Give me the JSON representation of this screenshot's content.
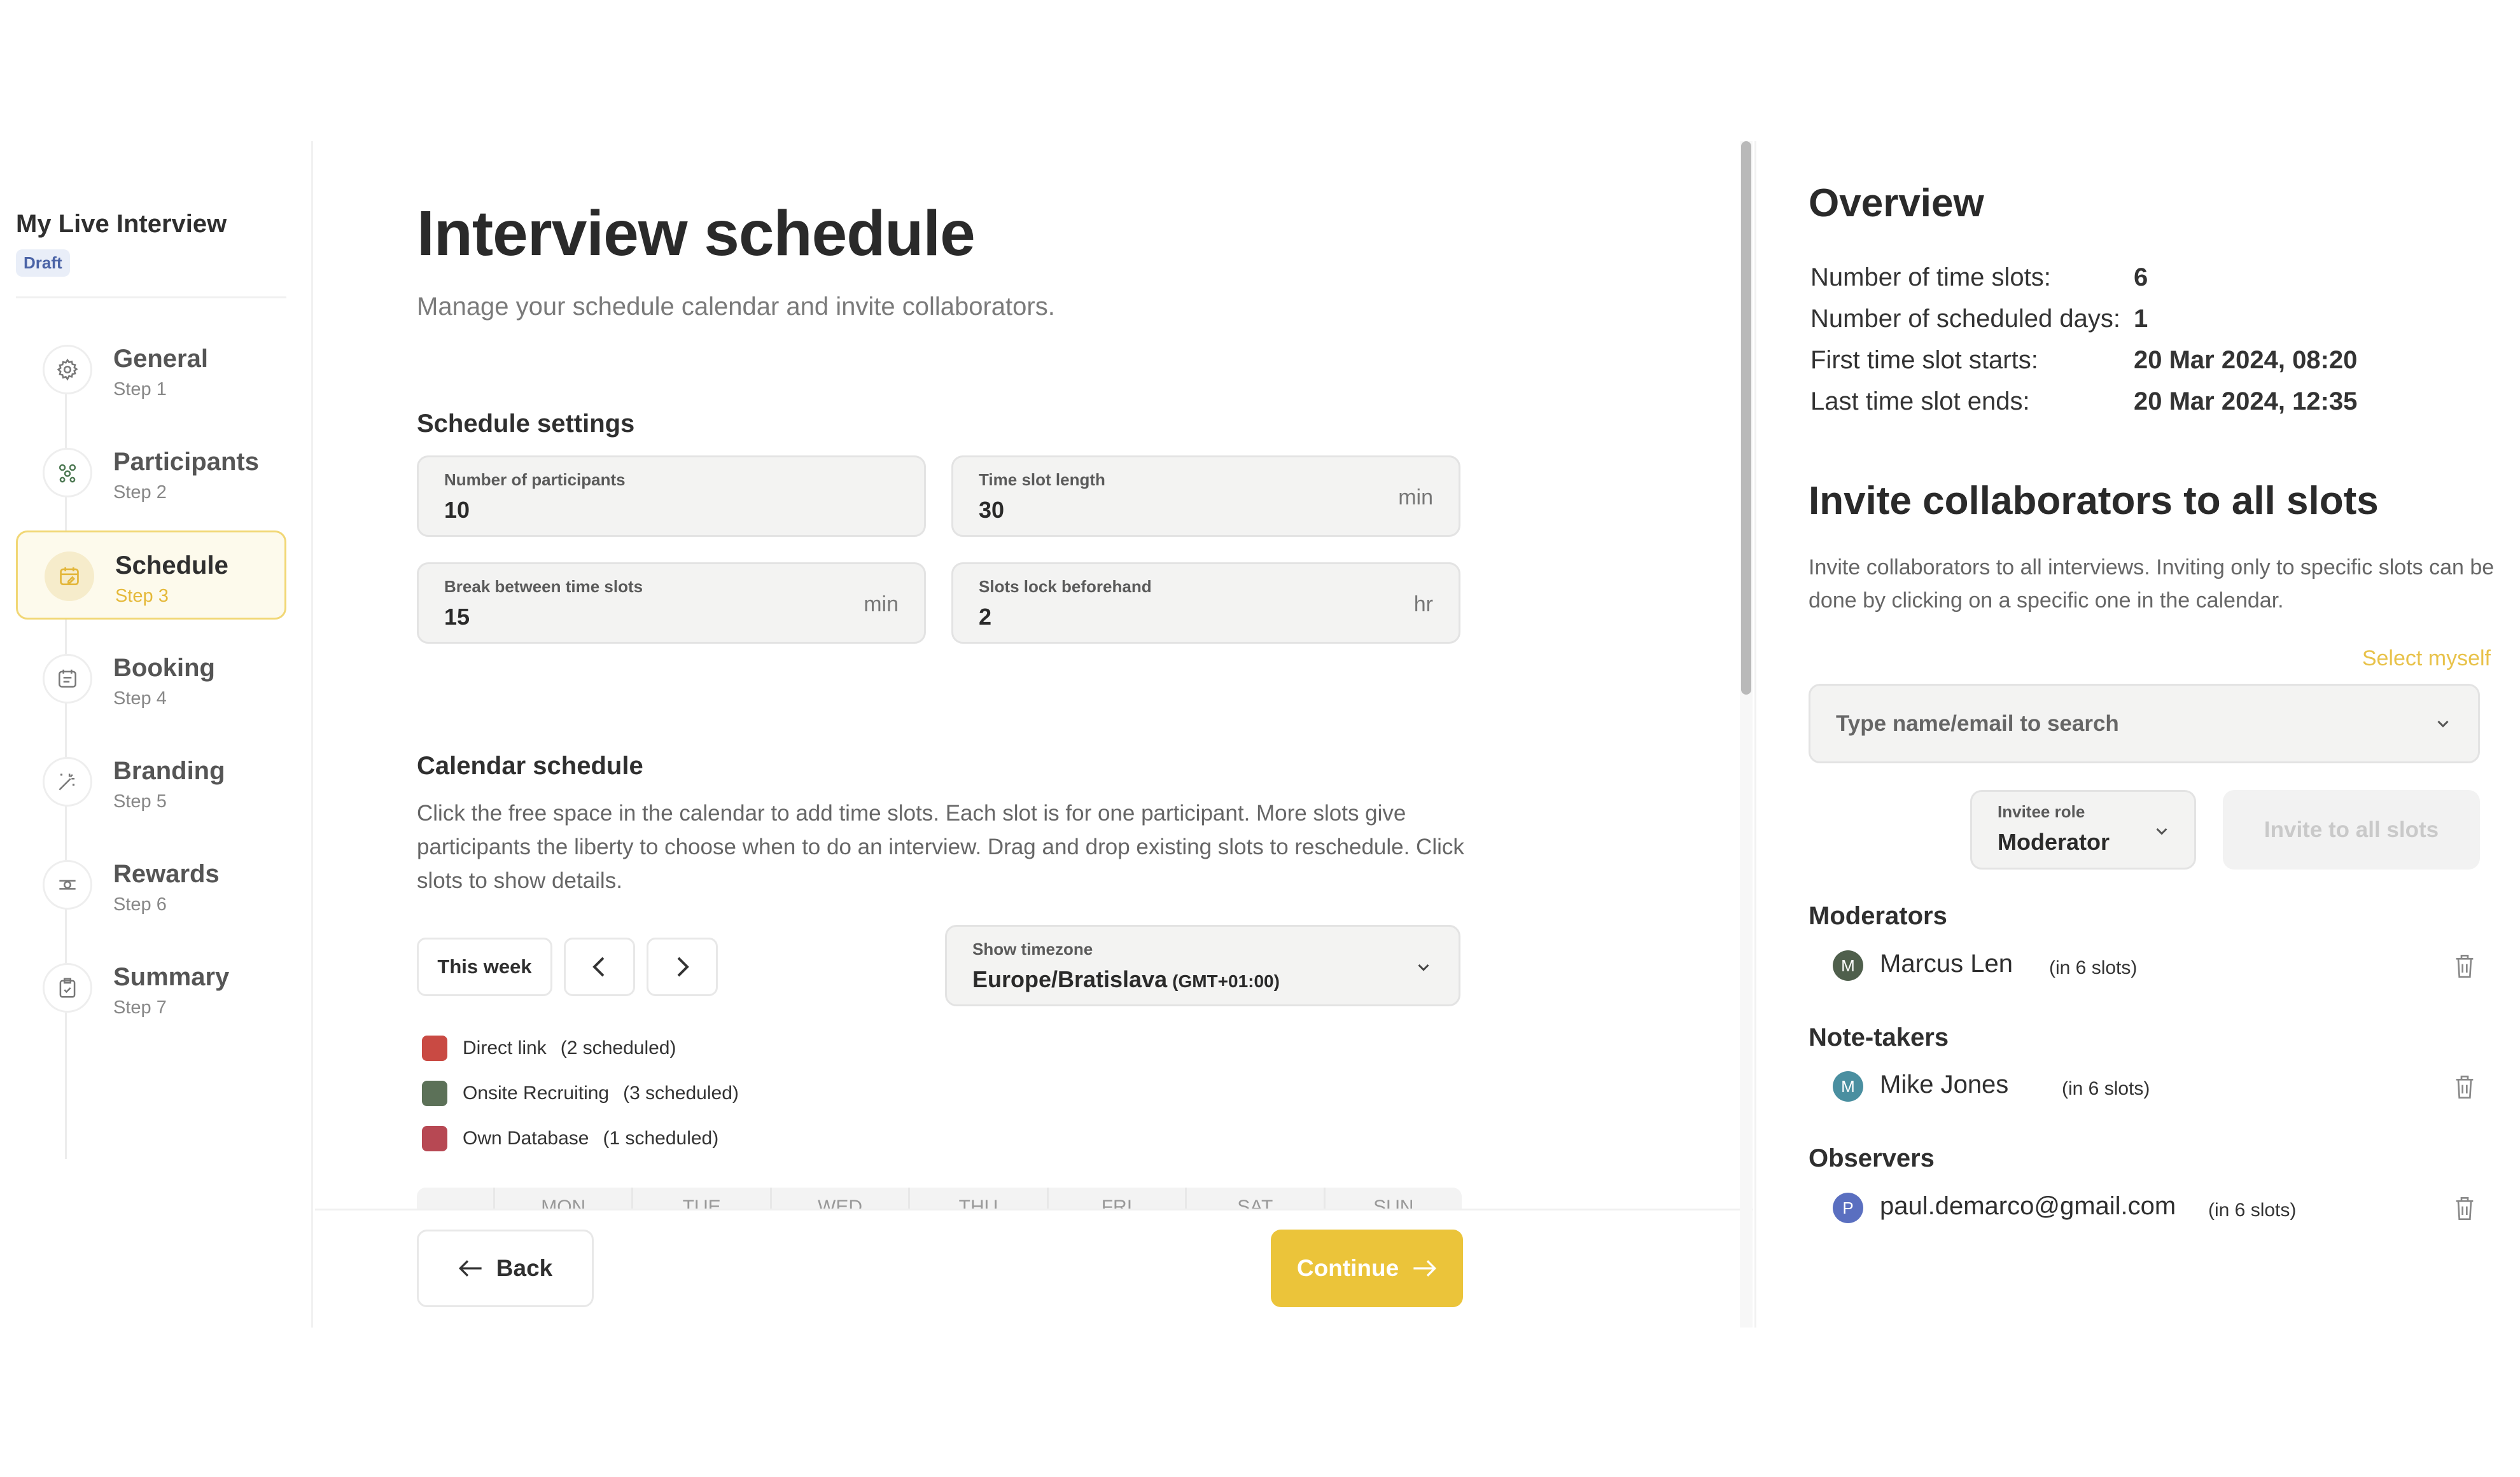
{
  "sidebar": {
    "project_title": "My Live Interview",
    "status_badge": "Draft",
    "steps": [
      {
        "name": "General",
        "sub": "Step 1",
        "icon": "gear-icon"
      },
      {
        "name": "Participants",
        "sub": "Step 2",
        "icon": "participants-icon"
      },
      {
        "name": "Schedule",
        "sub": "Step 3",
        "icon": "calendar-edit-icon"
      },
      {
        "name": "Booking",
        "sub": "Step 4",
        "icon": "booking-icon"
      },
      {
        "name": "Branding",
        "sub": "Step 5",
        "icon": "magic-wand-icon"
      },
      {
        "name": "Rewards",
        "sub": "Step 6",
        "icon": "rewards-icon"
      },
      {
        "name": "Summary",
        "sub": "Step 7",
        "icon": "clipboard-check-icon"
      }
    ],
    "active_step": 3
  },
  "main": {
    "title": "Interview schedule",
    "subtitle": "Manage your schedule calendar and invite collaborators.",
    "schedule_settings": {
      "title": "Schedule settings",
      "fields": [
        {
          "label": "Number of participants",
          "value": "10",
          "unit": ""
        },
        {
          "label": "Time slot length",
          "value": "30",
          "unit": "min"
        },
        {
          "label": "Break between time slots",
          "value": "15",
          "unit": "min"
        },
        {
          "label": "Slots lock beforehand",
          "value": "2",
          "unit": "hr"
        }
      ]
    },
    "calendar": {
      "title": "Calendar schedule",
      "description": "Click the free space in the calendar to add time slots. Each slot is for one participant. More slots give participants the liberty to choose when to do an interview. Drag and drop existing slots to reschedule. Click slots to show details.",
      "this_week_label": "This week",
      "timezone": {
        "label": "Show timezone",
        "value": "Europe/Bratislava",
        "offset": "(GMT+01:00)"
      },
      "legend": [
        {
          "name": "Direct link",
          "count": "(2 scheduled)",
          "color": "#c94a43"
        },
        {
          "name": "Onsite Recruiting",
          "count": "(3 scheduled)",
          "color": "#5c7158"
        },
        {
          "name": "Own Database",
          "count": "(1 scheduled)",
          "color": "#b74853"
        }
      ],
      "days": [
        "MON",
        "TUE",
        "WED",
        "THU",
        "FRI",
        "SAT",
        "SUN"
      ]
    },
    "footer": {
      "back_label": "Back",
      "continue_label": "Continue"
    }
  },
  "overview": {
    "title": "Overview",
    "rows": [
      {
        "key": "Number of time slots:",
        "value": "6"
      },
      {
        "key": "Number of scheduled days:",
        "value": "1"
      },
      {
        "key": "First time slot starts:",
        "value": "20 Mar 2024, 08:20"
      },
      {
        "key": "Last time slot ends:",
        "value": "20 Mar 2024, 12:35"
      }
    ]
  },
  "invite": {
    "title": "Invite collaborators to all slots",
    "description": "Invite collaborators to all interviews. Inviting only to specific slots can be done by clicking on a specific one in the calendar.",
    "select_myself": "Select myself",
    "search_placeholder": "Type name/email to search",
    "role_label": "Invitee role",
    "role_value": "Moderator",
    "invite_button": "Invite to all slots",
    "groups": [
      {
        "title": "Moderators",
        "people": [
          {
            "initial": "M",
            "name": "Marcus Len",
            "slots": "(in 6 slots)",
            "color": "#4f5f4c"
          }
        ]
      },
      {
        "title": "Note-takers",
        "people": [
          {
            "initial": "M",
            "name": "Mike Jones",
            "slots": "(in 6 slots)",
            "color": "#4a8fa0"
          }
        ]
      },
      {
        "title": "Observers",
        "people": [
          {
            "initial": "P",
            "name": "paul.demarco@gmail.com",
            "slots": "(in 6 slots)",
            "color": "#5a6fc0"
          }
        ]
      }
    ]
  }
}
